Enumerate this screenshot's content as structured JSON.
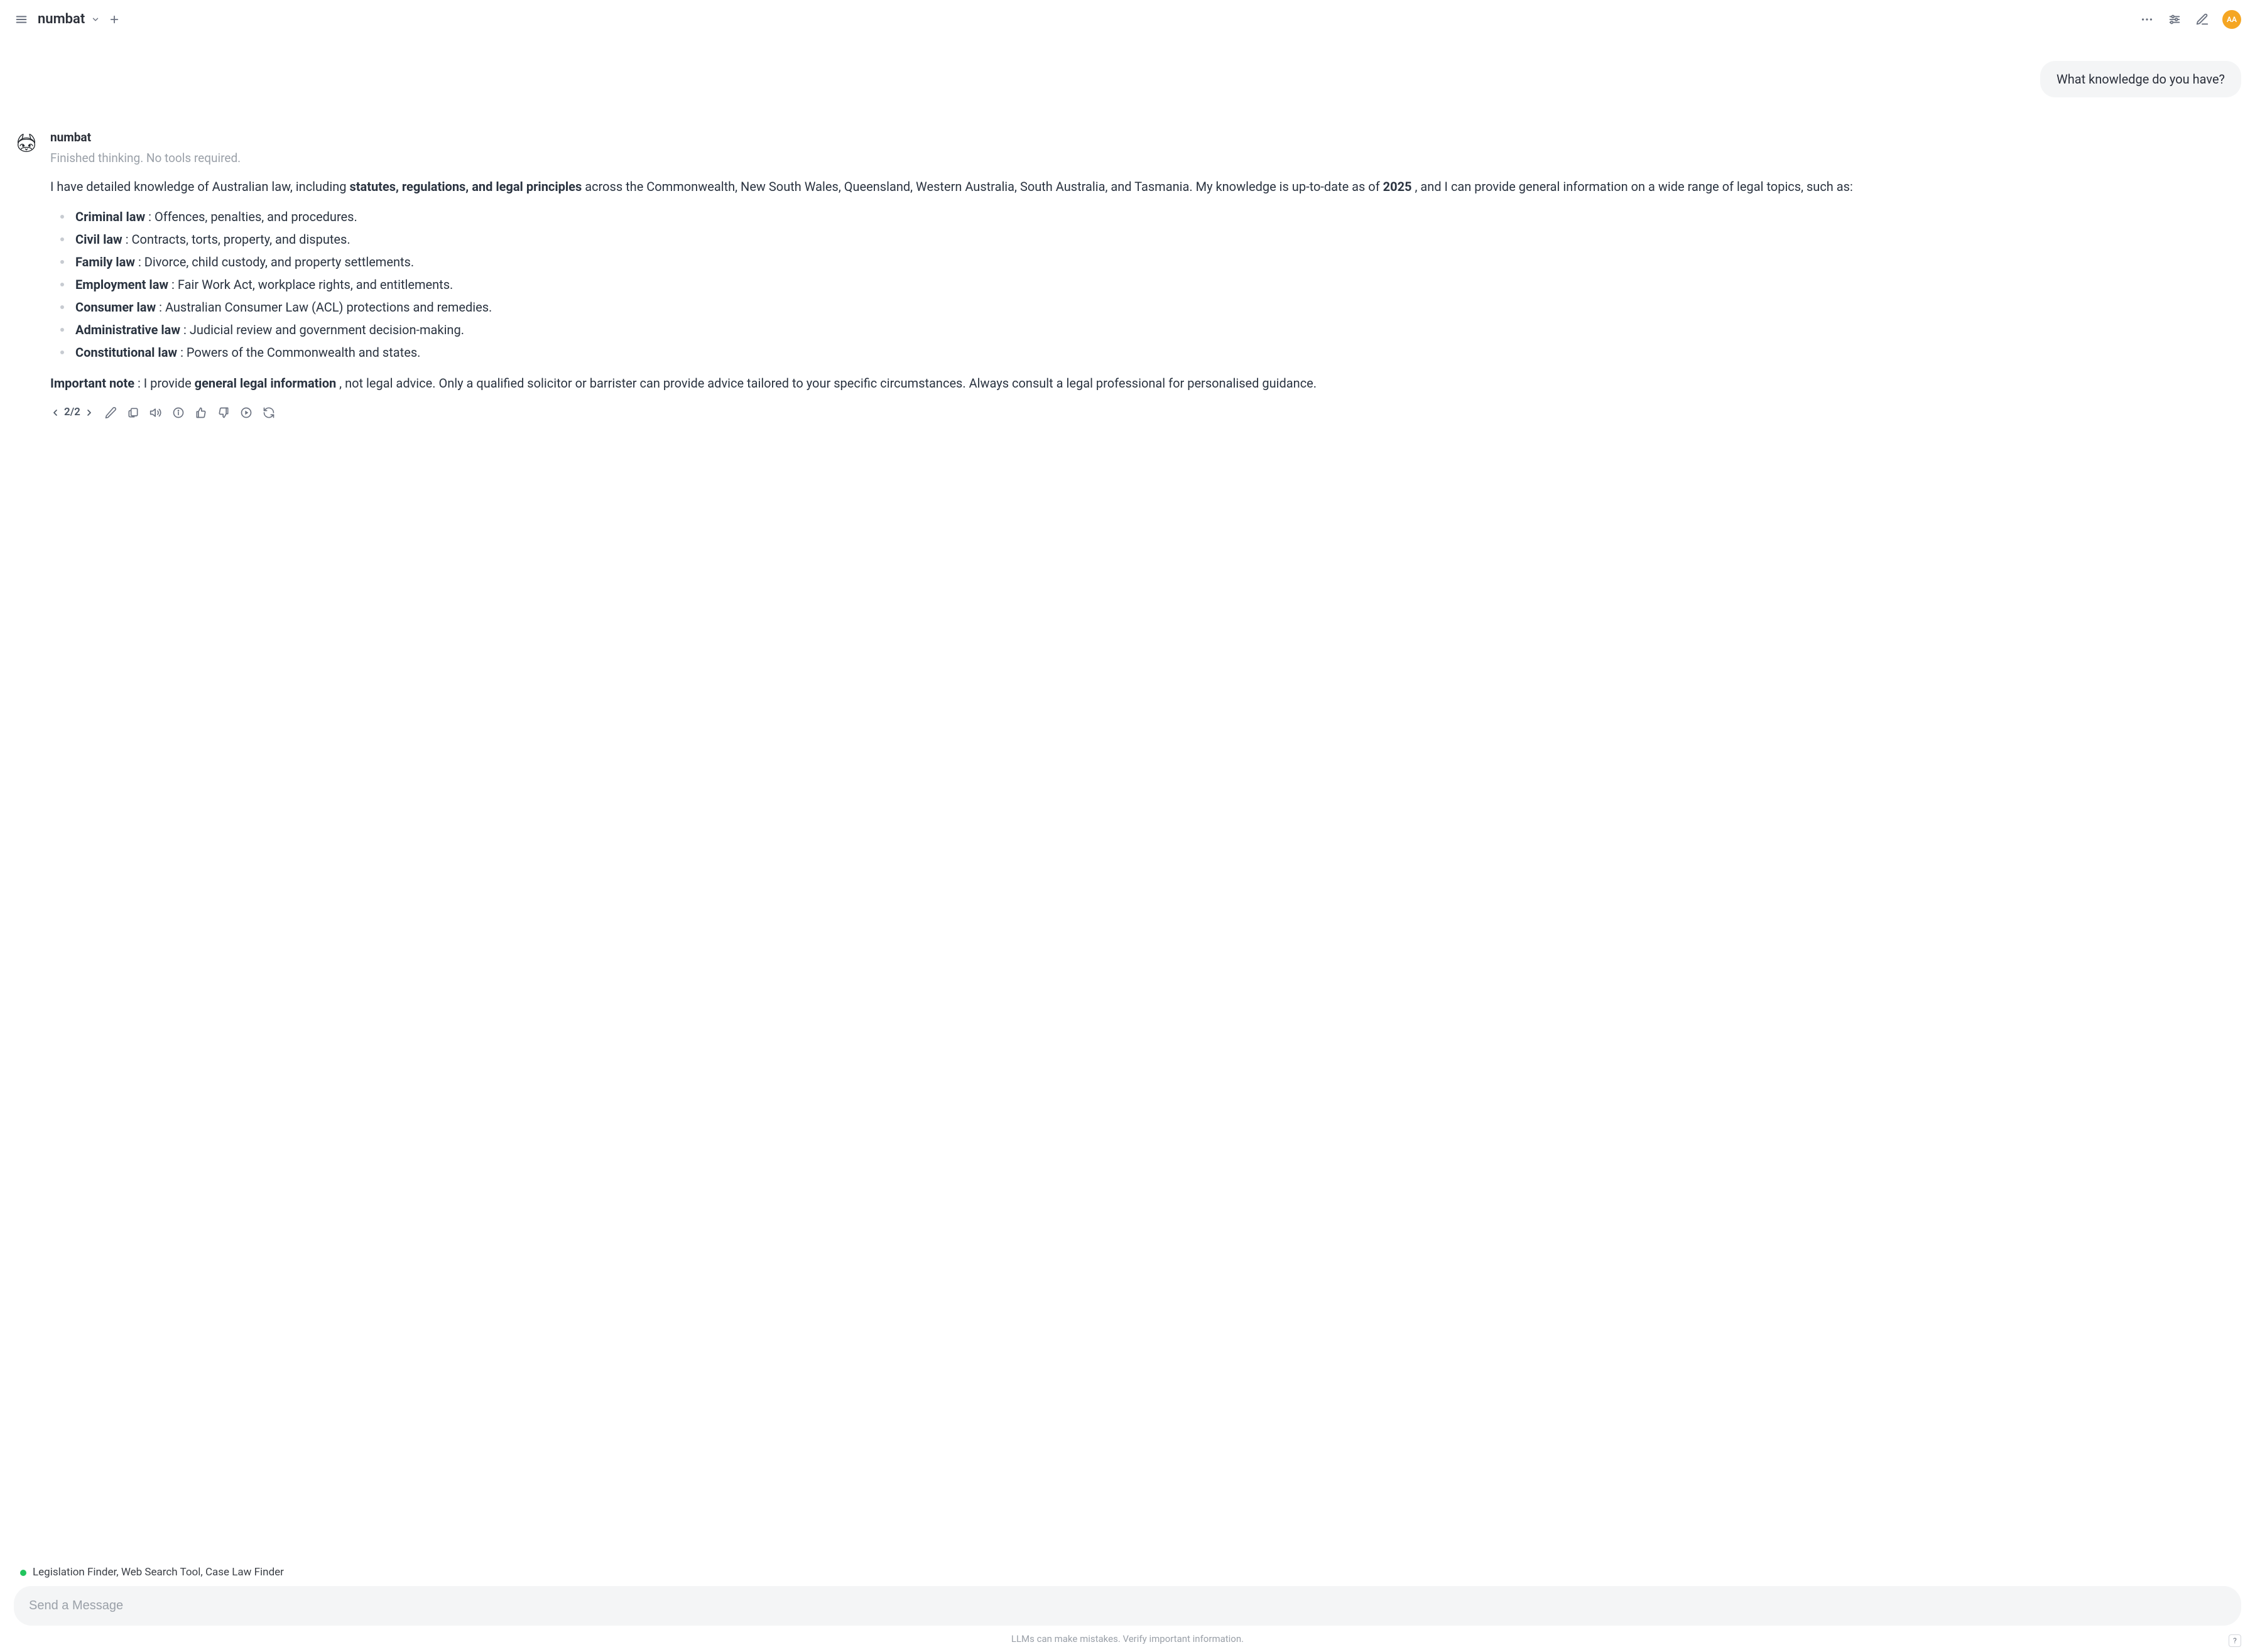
{
  "header": {
    "title": "numbat",
    "avatar_initials": "AA"
  },
  "conversation": {
    "user_message": "What knowledge do you have?",
    "assistant_name": "numbat",
    "status_line": "Finished thinking. No tools required.",
    "intro_pre": "I have detailed knowledge of Australian law, including ",
    "intro_bold": "statutes, regulations, and legal principles",
    "intro_mid": " across the Commonwealth, New South Wales, Queensland, Western Australia, South Australia, and Tasmania. My knowledge is up-to-date as of ",
    "intro_year": "2025",
    "intro_post": " , and I can provide general information on a wide range of legal topics, such as:",
    "topics": [
      {
        "bold": "Criminal law",
        "rest": " : Offences, penalties, and procedures."
      },
      {
        "bold": "Civil law",
        "rest": " : Contracts, torts, property, and disputes."
      },
      {
        "bold": "Family law",
        "rest": " : Divorce, child custody, and property settlements."
      },
      {
        "bold": "Employment law",
        "rest": " : Fair Work Act, workplace rights, and entitlements."
      },
      {
        "bold": "Consumer law",
        "rest": " : Australian Consumer Law (ACL) protections and remedies."
      },
      {
        "bold": "Administrative law",
        "rest": " : Judicial review and government decision-making."
      },
      {
        "bold": "Constitutional law",
        "rest": " : Powers of the Commonwealth and states."
      }
    ],
    "note_label": "Important note",
    "note_mid1": " : I provide ",
    "note_bold": "general legal information",
    "note_mid2": " , not legal advice. Only a qualified solicitor or barrister can provide advice tailored to your specific circumstances. Always consult a legal professional for personalised guidance."
  },
  "toolbar": {
    "page_indicator": "2/2"
  },
  "footer": {
    "tools_line": "Legislation Finder, Web Search Tool, Case Law Finder",
    "composer_placeholder": "Send a Message",
    "disclaimer": "LLMs can make mistakes. Verify important information.",
    "help": "?"
  }
}
